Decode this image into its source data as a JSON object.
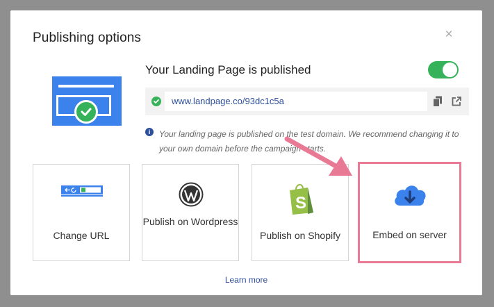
{
  "modal": {
    "title": "Publishing options",
    "close_icon": "close-icon"
  },
  "status": {
    "title": "Your Landing Page is published",
    "toggle_on": true,
    "url": "www.landpage.co/93dc1c5a",
    "info": "Your landing page is published on the test domain. We recommend changing it to your own domain before the campaign starts."
  },
  "options": [
    {
      "label": "Change URL",
      "icon": "browser-url-icon"
    },
    {
      "label": "Publish on Wordpress",
      "icon": "wordpress-icon"
    },
    {
      "label": "Publish on Shopify",
      "icon": "shopify-icon"
    },
    {
      "label": "Embed on server",
      "icon": "cloud-download-icon"
    }
  ],
  "footer": {
    "learn_more": "Learn more"
  },
  "colors": {
    "accent_blue": "#3b82ec",
    "success_green": "#36b35a",
    "highlight_pink": "#e87a96",
    "link_blue": "#2e4f9c"
  }
}
